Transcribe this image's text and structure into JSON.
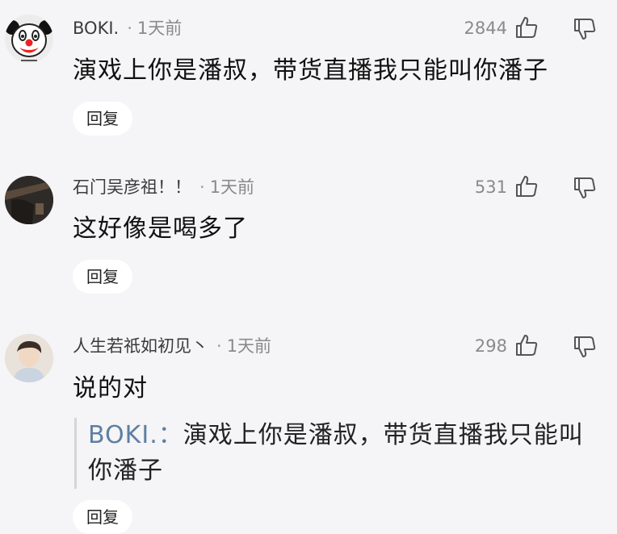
{
  "comments": [
    {
      "username": "BOKI.",
      "time": "1天前",
      "likes": "2844",
      "content": "演戏上你是潘叔，带货直播我只能叫你潘子",
      "reply_label": "回复",
      "avatar": "clown-face-avatar"
    },
    {
      "username": "石门吴彦祖！！",
      "time": "1天前",
      "likes": "531",
      "content": "这好像是喝多了",
      "reply_label": "回复",
      "avatar": "dark-photo-avatar"
    },
    {
      "username": "人生若祇如初见丶",
      "time": "1天前",
      "likes": "298",
      "content": "说的对",
      "quote_author": "BOKI.",
      "quote_sep": "：",
      "quote_text": "演戏上你是潘叔，带货直播我只能叫你潘子",
      "reply_label": "回复",
      "avatar": "person-photo-avatar"
    }
  ],
  "dot": "·",
  "icons": {
    "like": "thumbs-up-icon",
    "dislike": "thumbs-down-icon"
  },
  "colors": {
    "background": "#f5f4f6",
    "quote_author": "#5d7fa3",
    "meta": "#8a8a8a"
  }
}
